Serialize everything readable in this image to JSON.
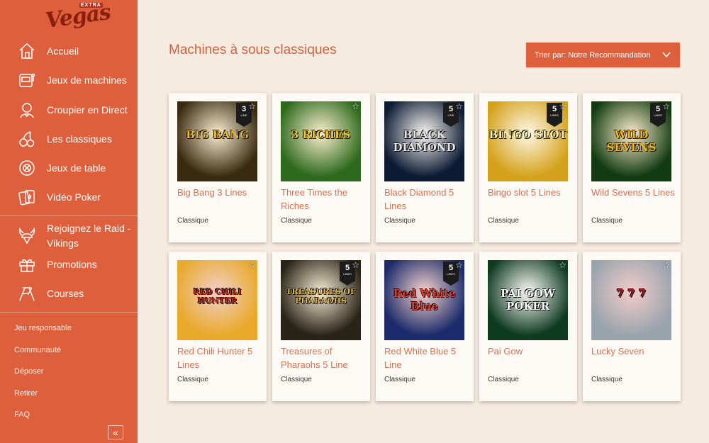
{
  "brand": {
    "logo_small": "EXTRA",
    "logo_main": "Vegas"
  },
  "sidebar": {
    "items": [
      {
        "label": "Accueil",
        "icon": "home-icon"
      },
      {
        "label": "Jeux de machines",
        "icon": "slot-machine-icon"
      },
      {
        "label": "Croupier en Direct",
        "icon": "dealer-icon"
      },
      {
        "label": "Les classiques",
        "icon": "cherries-icon"
      },
      {
        "label": "Jeux de table",
        "icon": "roulette-icon"
      },
      {
        "label": "Vidéo Poker",
        "icon": "cards-icon"
      }
    ],
    "promo_items": [
      {
        "label": "Rejoignez le Raid - Vikings",
        "icon": "viking-helmet-icon"
      },
      {
        "label": "Promotions",
        "icon": "gift-icon"
      },
      {
        "label": "Courses",
        "icon": "checkered-flags-icon"
      }
    ],
    "links": [
      "Jeu responsable",
      "Communauté",
      "Déposer",
      "Retirer",
      "FAQ"
    ],
    "collapse_label": "«"
  },
  "main": {
    "title": "Machines à sous classiques",
    "sort_label": "Trier par: Notre Recommandation",
    "games": [
      {
        "name": "Big Bang 3 Lines",
        "category": "Classique",
        "lines": "3",
        "lines_label": "LINE",
        "thumb_text": "BIG BANG",
        "thumb_bg": "#3a2b10",
        "thumb_fg": "#e8b93a"
      },
      {
        "name": "Three Times the Riches",
        "category": "Classique",
        "lines": "",
        "lines_label": "",
        "thumb_text": "3 RICHES",
        "thumb_bg": "#2e6a1e",
        "thumb_fg": "#f2c531"
      },
      {
        "name": "Black Diamond 5 Lines",
        "category": "Classique",
        "lines": "5",
        "lines_label": "LINE",
        "thumb_text": "BLACK DIAMOND",
        "thumb_bg": "#0c1a33",
        "thumb_fg": "#e6e6e6"
      },
      {
        "name": "Bingo slot 5 Lines",
        "category": "Classique",
        "lines": "5",
        "lines_label": "LINES",
        "thumb_text": "BINGO SLOT",
        "thumb_bg": "#d4a21c",
        "thumb_fg": "#fff3b0"
      },
      {
        "name": "Wild Sevens 5 Lines",
        "category": "Classique",
        "lines": "5",
        "lines_label": "LINES",
        "thumb_text": "WILD SEVENS",
        "thumb_bg": "#123b12",
        "thumb_fg": "#f2b51e"
      },
      {
        "name": "Red Chili Hunter 5 Lines",
        "category": "Classique",
        "lines": "",
        "lines_label": "",
        "thumb_text": "RED CHILI HUNTER",
        "thumb_bg": "#e9a92a",
        "thumb_fg": "#c5261a"
      },
      {
        "name": "Treasures of Pharaohs 5 Line",
        "category": "Classique",
        "lines": "5",
        "lines_label": "LINES",
        "thumb_text": "TREASURES OF PHARAOHS",
        "thumb_bg": "#2a2418",
        "thumb_fg": "#e3b84a"
      },
      {
        "name": "Red White Blue 5 Line",
        "category": "Classique",
        "lines": "5",
        "lines_label": "LINES",
        "thumb_text": "Red White Blue",
        "thumb_bg": "#1b2b6b",
        "thumb_fg": "#e23b2b"
      },
      {
        "name": "Pai Gow",
        "category": "Classique",
        "lines": "",
        "lines_label": "",
        "thumb_text": "PAI GOW POKER",
        "thumb_bg": "#0f3b22",
        "thumb_fg": "#ffffff"
      },
      {
        "name": "Lucky Seven",
        "category": "Classique",
        "lines": "",
        "lines_label": "",
        "thumb_text": "7 7 7",
        "thumb_bg": "#9aa4ad",
        "thumb_fg": "#c8151b"
      }
    ]
  },
  "colors": {
    "accent": "#dd5f3c",
    "background": "#f6ebe0",
    "title": "#c9623f"
  }
}
